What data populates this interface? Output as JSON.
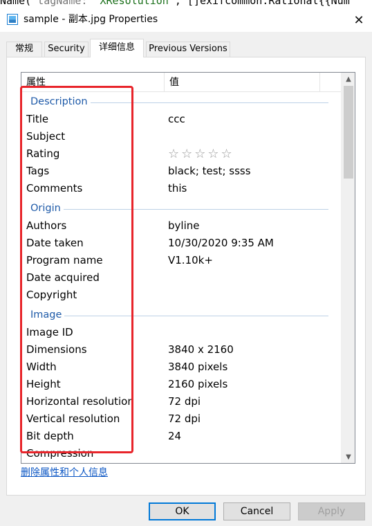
{
  "background_code": {
    "t1": "Name(",
    "t2": "tagName:",
    "t3": "\"XResolution\"",
    "t4": ", []exifcommon.Rational{{Num"
  },
  "window": {
    "title": "sample - 副本.jpg Properties",
    "close_label": "✕"
  },
  "tabs": [
    {
      "label": "常规"
    },
    {
      "label": "Security"
    },
    {
      "label": "详细信息"
    },
    {
      "label": "Previous Versions"
    }
  ],
  "list": {
    "header_name": "属性",
    "header_value": "值",
    "groups": {
      "description": "Description",
      "origin": "Origin",
      "image": "Image"
    },
    "rows": {
      "title": {
        "name": "Title",
        "value": "ccc"
      },
      "subject": {
        "name": "Subject",
        "value": ""
      },
      "rating": {
        "name": "Rating",
        "value": "☆☆☆☆☆",
        "stars": 0,
        "max_stars": 5
      },
      "tags": {
        "name": "Tags",
        "value": "black; test; ssss"
      },
      "comments": {
        "name": "Comments",
        "value": "this"
      },
      "authors": {
        "name": "Authors",
        "value": "byline"
      },
      "date_taken": {
        "name": "Date taken",
        "value": "10/30/2020 9:35 AM"
      },
      "program_name": {
        "name": "Program name",
        "value": "V1.10k+"
      },
      "date_acquired": {
        "name": "Date acquired",
        "value": ""
      },
      "copyright": {
        "name": "Copyright",
        "value": ""
      },
      "image_id": {
        "name": "Image ID",
        "value": ""
      },
      "dimensions": {
        "name": "Dimensions",
        "value": "3840 x 2160"
      },
      "width": {
        "name": "Width",
        "value": "3840 pixels"
      },
      "height": {
        "name": "Height",
        "value": "2160 pixels"
      },
      "h_res": {
        "name": "Horizontal resolution",
        "value": "72 dpi"
      },
      "v_res": {
        "name": "Vertical resolution",
        "value": "72 dpi"
      },
      "bit_depth": {
        "name": "Bit depth",
        "value": "24"
      },
      "compression": {
        "name": "Compression",
        "value": ""
      }
    }
  },
  "remove_link": "删除属性和个人信息",
  "buttons": {
    "ok": "OK",
    "cancel": "Cancel",
    "apply": "Apply"
  },
  "colors": {
    "annotation": "#e8242a",
    "group_heading": "#1e5aa8",
    "link": "#0b56c4"
  }
}
